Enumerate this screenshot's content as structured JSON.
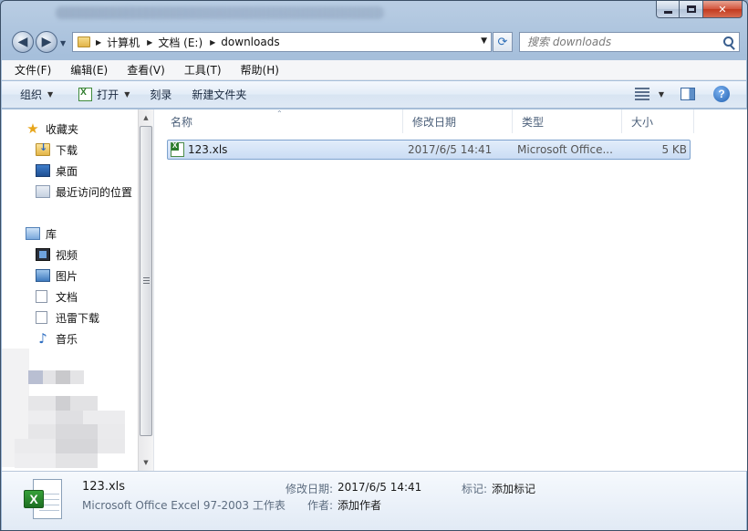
{
  "address": {
    "crumbs": [
      "计算机",
      "文档 (E:)",
      "downloads"
    ]
  },
  "search": {
    "placeholder": "搜索 downloads"
  },
  "menu": [
    "文件(F)",
    "编辑(E)",
    "查看(V)",
    "工具(T)",
    "帮助(H)"
  ],
  "commands": {
    "organize": "组织",
    "open": "打开",
    "burn": "刻录",
    "new_folder": "新建文件夹"
  },
  "nav": {
    "favorites": "收藏夹",
    "downloads": "下载",
    "desktop": "桌面",
    "recent": "最近访问的位置",
    "libraries": "库",
    "videos": "视频",
    "pictures": "图片",
    "documents": "文档",
    "xunlei": "迅雷下载",
    "music": "音乐"
  },
  "columns": {
    "name": "名称",
    "date": "修改日期",
    "type": "类型",
    "size": "大小"
  },
  "files": [
    {
      "name": "123.xls",
      "date": "2017/6/5 14:41",
      "type": "Microsoft Office...",
      "size": "5 KB"
    }
  ],
  "details": {
    "name": "123.xls",
    "type": "Microsoft Office Excel 97-2003 工作表",
    "modified_label": "修改日期:",
    "modified_value": "2017/6/5 14:41",
    "author_label": "作者:",
    "author_value": "添加作者",
    "tags_label": "标记:",
    "tags_value": "添加标记"
  },
  "colors": {
    "selection": "#cadcf4",
    "selection_border": "#7da2ce",
    "frame": "#a6bfdb"
  },
  "icons": [
    "back-arrow-icon",
    "forward-arrow-icon",
    "folder-icon",
    "refresh-icon",
    "search-icon",
    "excel-icon",
    "views-icon",
    "preview-pane-icon",
    "help-icon",
    "star-icon",
    "library-icon",
    "video-icon",
    "picture-icon",
    "document-icon",
    "music-icon"
  ]
}
